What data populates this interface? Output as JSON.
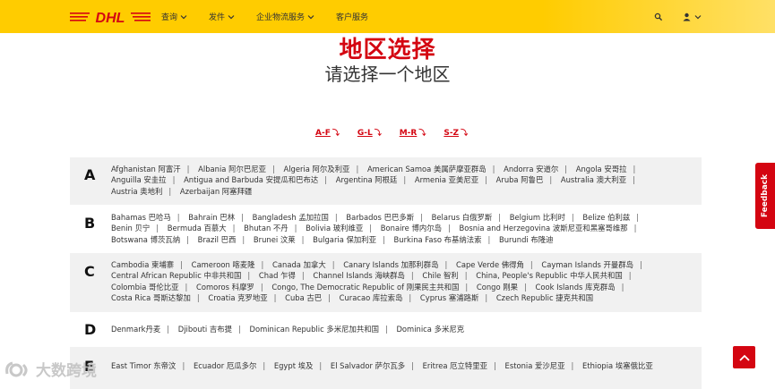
{
  "header": {
    "logo_text": "DHL",
    "nav": [
      {
        "label": "查询"
      },
      {
        "label": "发件"
      },
      {
        "label": "企业物流服务"
      },
      {
        "label": "客户服务"
      }
    ]
  },
  "page": {
    "title": "地区选择",
    "subtitle": "请选择一个地区"
  },
  "az_links": [
    {
      "label": "A-F",
      "arrow": "⤵"
    },
    {
      "label": "G-L",
      "arrow": "⤵"
    },
    {
      "label": "M-R",
      "arrow": "⤵"
    },
    {
      "label": "S-Z",
      "arrow": "⤵"
    }
  ],
  "sections": [
    {
      "letter": "A",
      "countries": [
        "Afghanistan 阿富汗",
        "Albania 阿尔巴尼亚",
        "Algeria 阿尔及利亚",
        "American Samoa 美属萨摩亚群岛",
        "Andorra 安道尔",
        "Angola 安哥拉",
        "Anguilla 安圭拉",
        "Antigua and Barbuda 安提瓜和巴布达",
        "Argentina 阿根廷",
        "Armenia 亚美尼亚",
        "Aruba 阿鲁巴",
        "Australia 澳大利亚",
        "Austria 奥地利",
        "Azerbaijan 阿塞拜疆"
      ]
    },
    {
      "letter": "B",
      "countries": [
        "Bahamas 巴哈马",
        "Bahrain 巴林",
        "Bangladesh 孟加拉国",
        "Barbados 巴巴多斯",
        "Belarus 白俄罗斯",
        "Belgium 比利时",
        "Belize 伯利兹",
        "Benin 贝宁",
        "Bermuda 百慕大",
        "Bhutan 不丹",
        "Bolivia 玻利维亚",
        "Bonaire 博内尔岛",
        "Bosnia and Herzegovina 波斯尼亚和黑塞哥维那",
        "Botswana 博茨瓦纳",
        "Brazil 巴西",
        "Brunei 汶莱",
        "Bulgaria 保加利亚",
        "Burkina Faso 布基纳法索",
        "Burundi 布隆迪"
      ]
    },
    {
      "letter": "C",
      "countries": [
        "Cambodia 柬埔寨",
        "Cameroon 喀麦隆",
        "Canada 加拿大",
        "Canary Islands 加那利群岛",
        "Cape Verde 佛得角",
        "Cayman Islands 开曼群岛",
        "Central African Republic 中非共和国",
        "Chad 乍得",
        "Channel Islands 海峡群岛",
        "Chile 智利",
        "China, People's Republic 中华人民共和国",
        "Colombia 哥伦比亚",
        "Comoros 科摩罗",
        "Congo, The Democratic Republic of 刚果民主共和国",
        "Congo 刚果",
        "Cook Islands 库克群岛",
        "Costa Rica 哥斯达黎加",
        "Croatia 克罗地亚",
        "Cuba 古巴",
        "Curacao 库拉索岛",
        "Cyprus 塞浦路斯",
        "Czech Republic 捷克共和国"
      ]
    },
    {
      "letter": "D",
      "countries": [
        "Denmark丹麦",
        "Djibouti 吉布提",
        "Dominican Republic 多米尼加共和国",
        "Dominica 多米尼克"
      ]
    },
    {
      "letter": "E",
      "countries": [
        "East Timor 东帝汶",
        "Ecuador 厄瓜多尔",
        "Egypt 埃及",
        "El Salvador 萨尔瓦多",
        "Eritrea 厄立特里亚",
        "Estonia 爱沙尼亚",
        "Ethiopia 埃塞俄比亚"
      ]
    }
  ],
  "feedback_label": "Feedback",
  "watermark_text": "大数跨境",
  "colors": {
    "brand_yellow": "#ffcc00",
    "brand_red": "#d40511",
    "row_shade": "#f1f1f1"
  }
}
